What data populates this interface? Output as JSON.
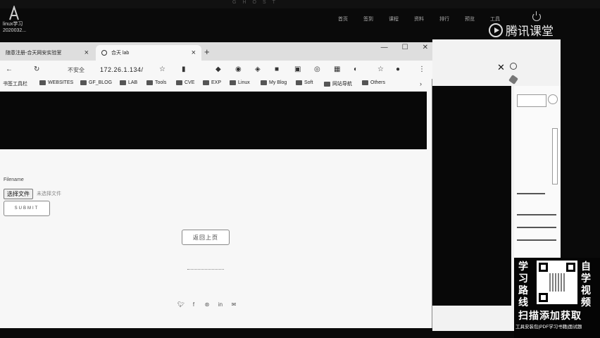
{
  "desktop": {
    "top_title": "GHOST",
    "icon_label_1": "linux学习",
    "icon_label_2": "2020032...",
    "menu": [
      "首页",
      "签到",
      "课程",
      "资料",
      "排行",
      "预览",
      "工具"
    ],
    "brand": "腾讯课堂"
  },
  "browser": {
    "tabs": [
      {
        "label": "随意注册-合天网安实验室"
      },
      {
        "label": "合天 lab"
      }
    ],
    "not_secure": "不安全",
    "url": "172.26.1.134/",
    "bookmarks": [
      {
        "label": "书签工具栏"
      },
      {
        "label": "WEBSITES"
      },
      {
        "label": "GF_BLOG"
      },
      {
        "label": "LAB"
      },
      {
        "label": "Tools"
      },
      {
        "label": "CVE"
      },
      {
        "label": "EXP"
      },
      {
        "label": "Linux"
      },
      {
        "label": "My Blog"
      },
      {
        "label": "Soft"
      },
      {
        "label": "网站导航"
      },
      {
        "label": "Others"
      }
    ]
  },
  "page": {
    "filename_label": "Filename",
    "choose_file": "选择文件",
    "no_file": "未选择文件",
    "submit": "SUBMIT",
    "back": "返回上页",
    "social_icons": [
      "twitter-icon",
      "facebook-icon",
      "dribbble-icon",
      "linkedin-icon",
      "mail-icon"
    ]
  },
  "promo": {
    "left_chars": [
      "学",
      "习",
      "路",
      "线"
    ],
    "right_chars": [
      "自",
      "学",
      "视",
      "频"
    ],
    "cta": "扫描添加获取",
    "sub": "工具安装包|PDF学习书籍|面试题"
  }
}
